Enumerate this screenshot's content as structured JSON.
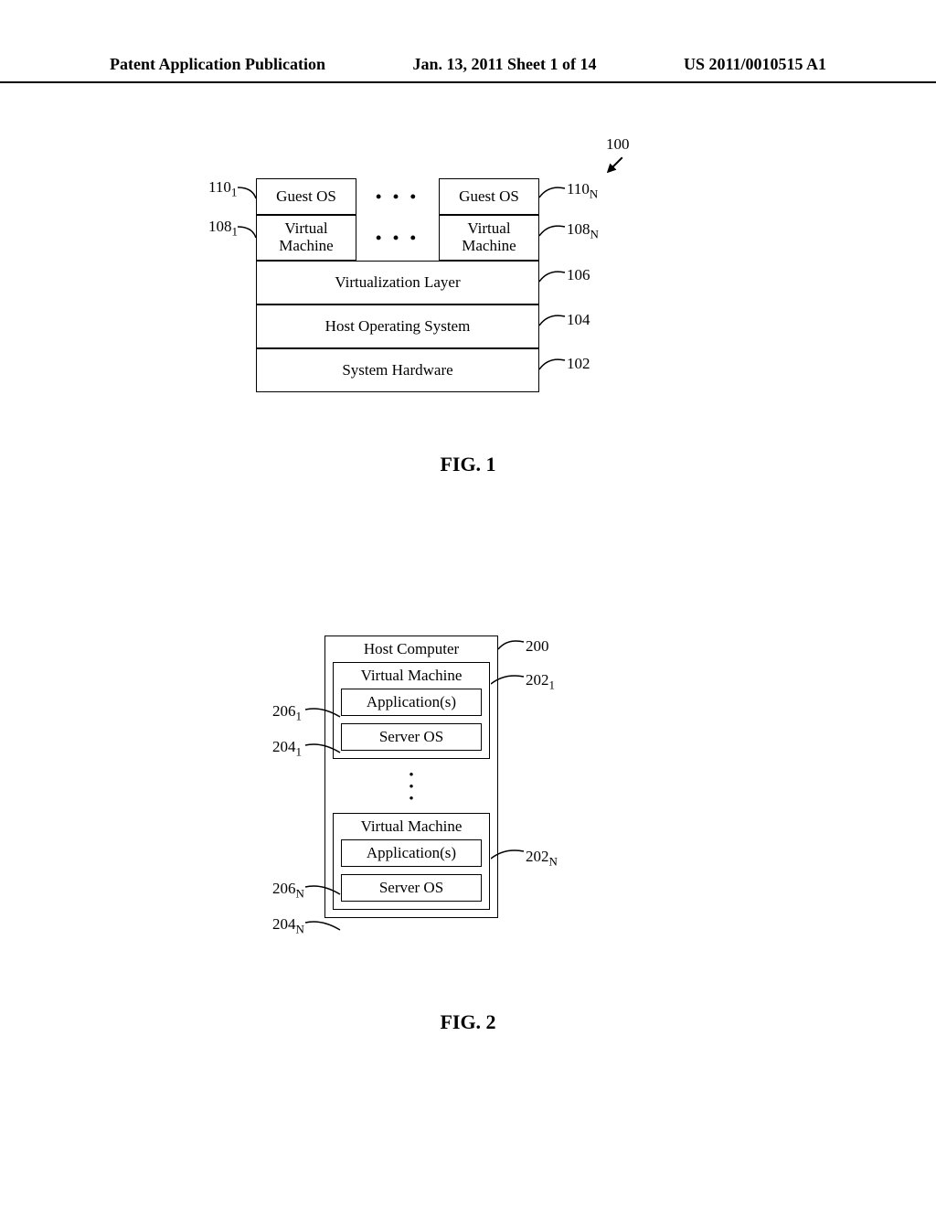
{
  "header": {
    "left": "Patent Application Publication",
    "center": "Jan. 13, 2011  Sheet 1 of 14",
    "right": "US 2011/0010515 A1"
  },
  "fig1": {
    "ref100": "100",
    "guest_os_1": "Guest OS",
    "guest_os_n": "Guest OS",
    "vm_1_line1": "Virtual",
    "vm_1_line2": "Machine",
    "vm_n_line1": "Virtual",
    "vm_n_line2": "Machine",
    "virtualization": "Virtualization Layer",
    "host_os": "Host Operating System",
    "hardware": "System Hardware",
    "dots": "• • •",
    "caption": "FIG. 1",
    "labels": {
      "l110_1": "110",
      "l110_1_sub": "1",
      "l110_n": "110",
      "l110_n_sub": "N",
      "l108_1": "108",
      "l108_1_sub": "1",
      "l108_n": "108",
      "l108_n_sub": "N",
      "l106": "106",
      "l104": "104",
      "l102": "102"
    }
  },
  "fig2": {
    "host": "Host Computer",
    "vm_title": "Virtual Machine",
    "apps": "Application(s)",
    "server_os": "Server OS",
    "caption": "FIG. 2",
    "labels": {
      "l200": "200",
      "l202_1": "202",
      "l202_1_sub": "1",
      "l202_n": "202",
      "l202_n_sub": "N",
      "l206_1": "206",
      "l206_1_sub": "1",
      "l206_n": "206",
      "l206_n_sub": "N",
      "l204_1": "204",
      "l204_1_sub": "1",
      "l204_n": "204",
      "l204_n_sub": "N"
    }
  }
}
